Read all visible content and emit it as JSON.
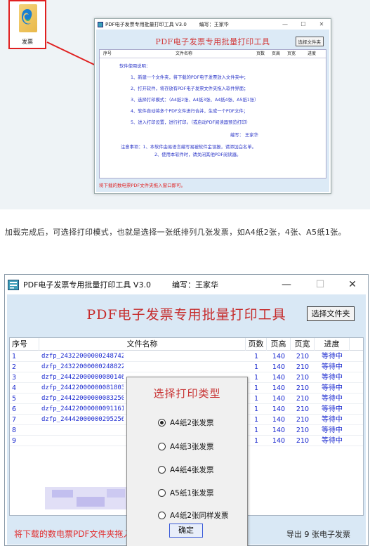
{
  "top_figure": {
    "folder_label": "发票",
    "window_title": "PDF电子发票专用批量打印工具 V3.0",
    "window_author": "编写：王家华",
    "heading": "PDF电子发票专用批量打印工具",
    "select_button": "选择文件夹",
    "columns": [
      "序号",
      "文件名称",
      "页数",
      "页高",
      "页宽",
      "进度"
    ],
    "instructions": [
      "软件使用说明：",
      "1、新建一个文件夹，将下载的PDF电子发票放入文件夹中；",
      "2、打开软件，将存放有PDF电子发票文件夹拖入软件界面；",
      "3、选择打印模式：（A4纸2张、A4纸3张、A4纸4张、A5纸1张）",
      "4、软件自动将多个PDF文件进行合并，生成一个PDF文件；",
      "5、进入打印设置，进行打印。（或启动PDF阅读器预览打印）",
      "编写：  王家华",
      "注意事项：1、本软件由易语言编写易被软件金误报，请添加白名单。",
      "2、使用本软件时，请关闭其他PDF阅读器。"
    ],
    "status": "将下载的数电票PDF文件夹拖入窗口即可。"
  },
  "paragraph": "加载完成后，可选择打印模式，也就是选择一张纸排列几张发票，如A4纸2张，4张、A5纸1张。",
  "window": {
    "title": "PDF电子发票专用批量打印工具 V3.0",
    "author": "编写：王家华",
    "controls": {
      "minimize": "—",
      "maximize": "☐",
      "close": "✕"
    },
    "heading": "PDF电子发票专用批量打印工具",
    "select_button": "选择文件夹",
    "columns": [
      "序号",
      "文件名称",
      "页数",
      "页高",
      "页宽",
      "进度"
    ],
    "rows": [
      {
        "no": "1",
        "name": "dzfp_24322000000248742",
        "pages": "1",
        "height": "140",
        "width": "210",
        "status": "等待中"
      },
      {
        "no": "2",
        "name": "dzfp_24322000000248822",
        "pages": "1",
        "height": "140",
        "width": "210",
        "status": "等待中"
      },
      {
        "no": "3",
        "name": "dzfp_24422000000080146",
        "pages": "1",
        "height": "140",
        "width": "210",
        "status": "等待中"
      },
      {
        "no": "4",
        "name": "dzfp_24422000000081803",
        "pages": "1",
        "height": "140",
        "width": "210",
        "status": "等待中"
      },
      {
        "no": "5",
        "name": "dzfp_24422000000083250",
        "pages": "1",
        "height": "140",
        "width": "210",
        "status": "等待中"
      },
      {
        "no": "6",
        "name": "dzfp_24422000000091161",
        "pages": "1",
        "height": "140",
        "width": "210",
        "status": "等待中"
      },
      {
        "no": "7",
        "name": "dzfp_24442000000295256",
        "pages": "1",
        "height": "140",
        "width": "210",
        "status": "等待中"
      },
      {
        "no": "8",
        "name": "",
        "pages": "1",
        "height": "140",
        "width": "210",
        "status": "等待中"
      },
      {
        "no": "9",
        "name": "",
        "pages": "1",
        "height": "140",
        "width": "210",
        "status": "等待中"
      }
    ],
    "status_left": "将下载的数电票PDF文件夹拖入窗口即可。",
    "status_right": "导出 9 张电子发票"
  },
  "dialog": {
    "title": "选择打印类型",
    "options": [
      {
        "label": "A4纸2张发票",
        "selected": true
      },
      {
        "label": "A4纸3张发票",
        "selected": false
      },
      {
        "label": "A4纸4张发票",
        "selected": false
      },
      {
        "label": "A5纸1张发票",
        "selected": false
      },
      {
        "label": "A4纸2张同样发票",
        "selected": false
      }
    ],
    "ok_button": "确定"
  },
  "colors": {
    "accent_red": "#c62b2b",
    "link_blue": "#1b2ad0",
    "client_bg": "#d9e8f5"
  }
}
